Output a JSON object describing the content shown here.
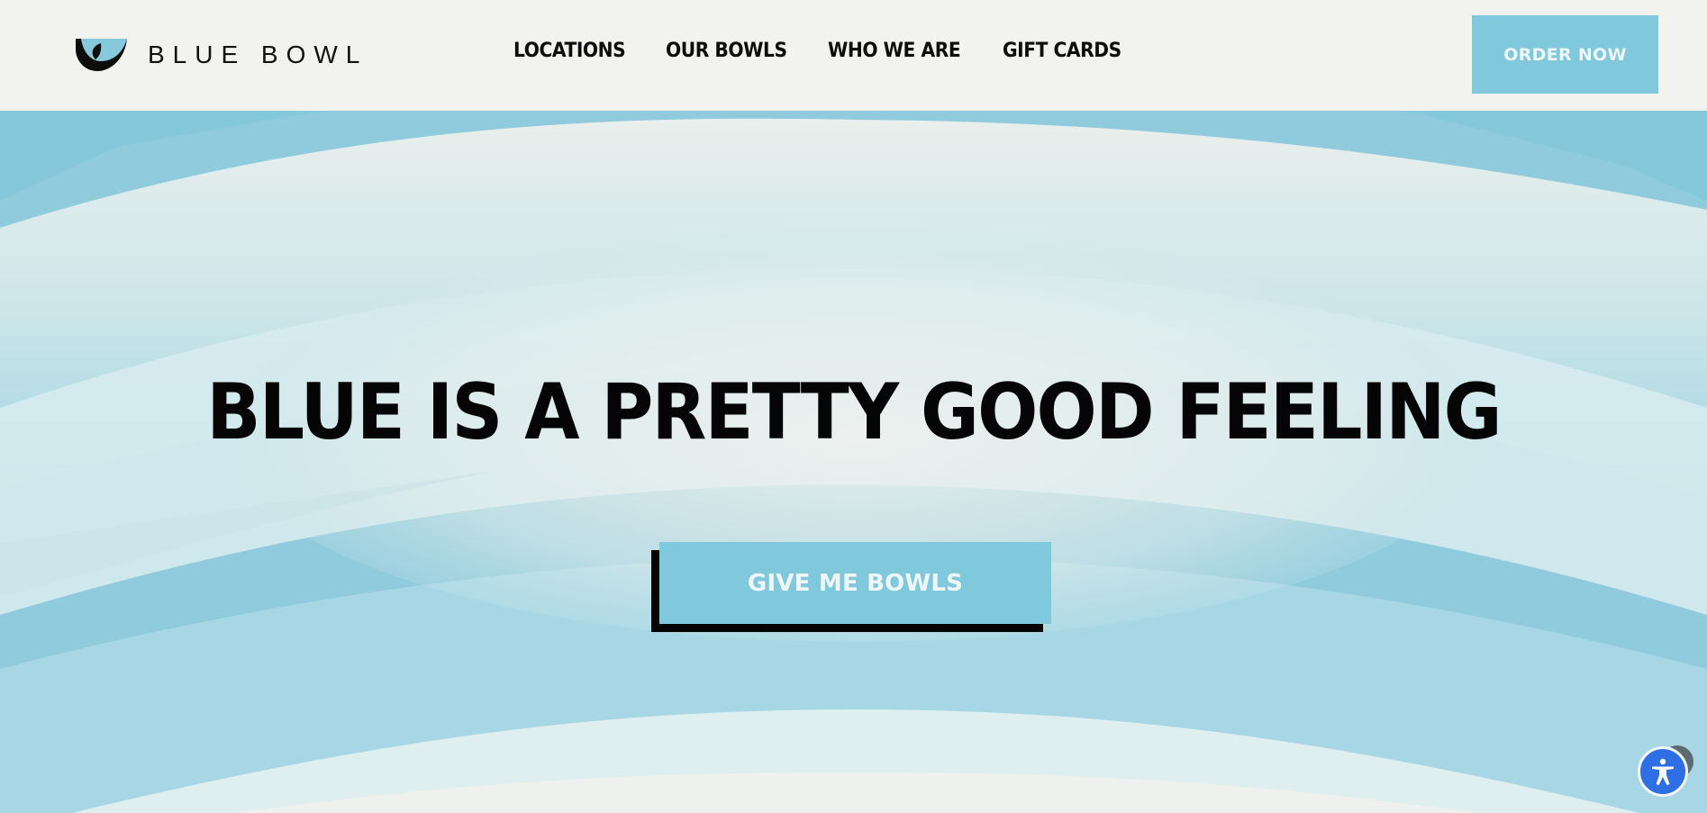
{
  "brand": {
    "name": "BLUE BOWL",
    "logo_icon": "bowl-leaf-icon"
  },
  "nav": {
    "items": [
      {
        "label": "LOCATIONS"
      },
      {
        "label": "OUR BOWLS"
      },
      {
        "label": "WHO WE ARE"
      },
      {
        "label": "GIFT CARDS"
      }
    ],
    "order_label": "ORDER NOW"
  },
  "hero": {
    "title": "BLUE IS A PRETTY GOOD FEELING",
    "cta_label": "GIVE ME BOWLS"
  },
  "accessibility": {
    "icon": "accessibility-person-icon"
  },
  "colors": {
    "header_bg": "#f2f2ee",
    "accent_blue": "#80c8dc",
    "text_dark": "#050505",
    "a11y_blue": "#2f6fe6"
  }
}
